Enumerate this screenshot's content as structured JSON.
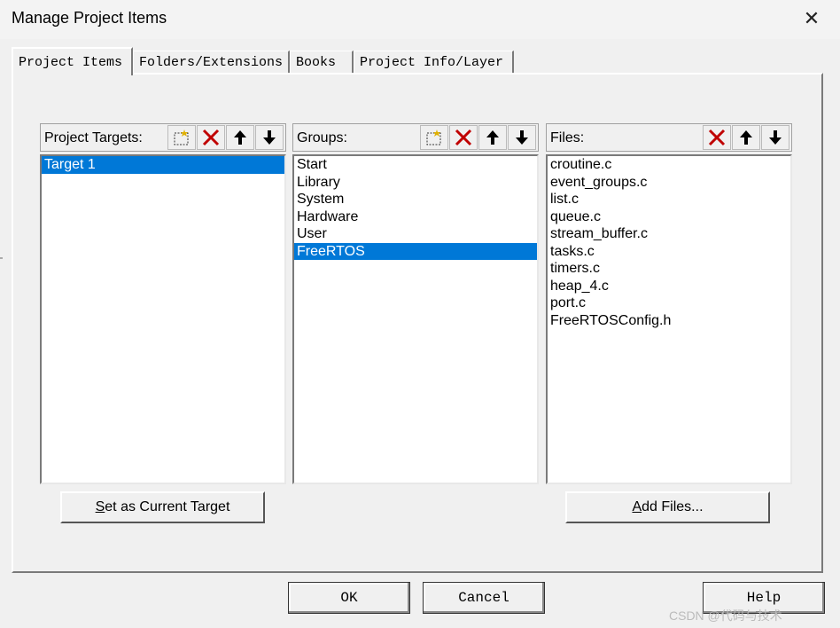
{
  "window": {
    "title": "Manage Project Items",
    "close_symbol": "✕"
  },
  "tabs": [
    {
      "label": "Project Items",
      "active": true
    },
    {
      "label": "Folders/Extensions",
      "active": false
    },
    {
      "label": "Books",
      "active": false
    },
    {
      "label": "Project Info/Layer",
      "active": false
    }
  ],
  "targets": {
    "label": "Project Targets:",
    "items": [
      "Target 1"
    ],
    "selected_index": 0
  },
  "groups": {
    "label": "Groups:",
    "items": [
      "Start",
      "Library",
      "System",
      "Hardware",
      "User",
      "FreeRTOS"
    ],
    "selected_index": 5
  },
  "files": {
    "label": "Files:",
    "items": [
      "croutine.c",
      "event_groups.c",
      "list.c",
      "queue.c",
      "stream_buffer.c",
      "tasks.c",
      "timers.c",
      "heap_4.c",
      "port.c",
      "FreeRTOSConfig.h"
    ]
  },
  "buttons": {
    "set_current_target": {
      "mnemonic": "S",
      "rest": "et as Current Target"
    },
    "add_files": {
      "mnemonic": "A",
      "rest": "dd Files..."
    },
    "ok": "OK",
    "cancel": "Cancel",
    "help": "Help"
  },
  "watermark": "CSDN @代码与技术",
  "colors": {
    "selection": "#0078d7",
    "delete_icon": "#c00000"
  },
  "icons": [
    "new-icon",
    "delete-icon",
    "move-up-icon",
    "move-down-icon",
    "close-icon"
  ]
}
